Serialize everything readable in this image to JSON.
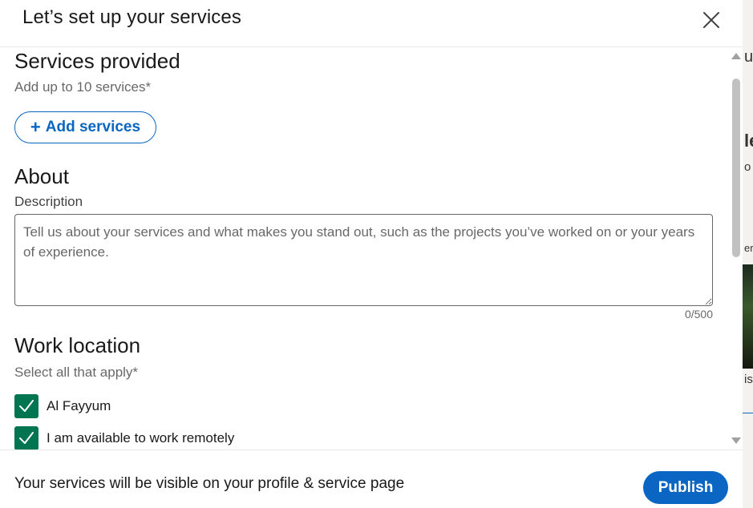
{
  "modal": {
    "title": "Let’s set up your services",
    "close_icon": "close-icon"
  },
  "services": {
    "title": "Services provided",
    "hint": "Add up to 10 services*",
    "add_button_label": "Add services",
    "add_icon": "+"
  },
  "about": {
    "title": "About",
    "description_label": "Description",
    "description_value": "",
    "description_placeholder": "Tell us about your services and what makes you stand out, such as the projects you’ve worked on or your years of experience.",
    "counter": "0/500"
  },
  "work_location": {
    "title": "Work location",
    "hint": "Select all that apply*",
    "options": [
      {
        "label": "Al Fayyum",
        "checked": true
      },
      {
        "label": "I am available to work remotely",
        "checked": true
      }
    ]
  },
  "footer": {
    "notice": "Your services will be visible on your profile & service page",
    "publish_label": "Publish"
  },
  "background_fragments": [
    "u",
    "le",
    "o",
    "er",
    "is"
  ],
  "colors": {
    "accent": "#0a66c2",
    "checkbox": "#01754f",
    "text_secondary": "rgba(0,0,0,0.6)"
  }
}
